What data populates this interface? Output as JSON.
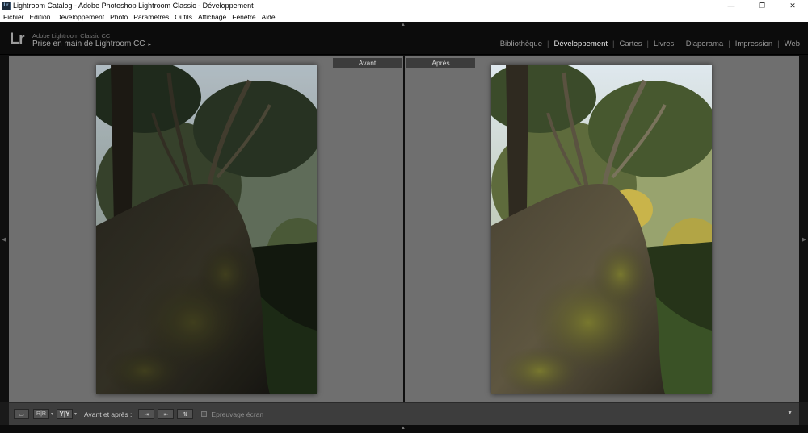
{
  "window": {
    "title": "Lightroom Catalog - Adobe Photoshop Lightroom Classic - Développement",
    "icon_label": "Lr",
    "controls": {
      "minimize": "—",
      "restore": "❐",
      "close": "✕"
    }
  },
  "menubar": {
    "items": [
      "Fichier",
      "Edition",
      "Développement",
      "Photo",
      "Paramètres",
      "Outils",
      "Affichage",
      "Fenêtre",
      "Aide"
    ]
  },
  "identity": {
    "logo": "Lr",
    "product": "Adobe Lightroom Classic CC",
    "catalog": "Prise en main de Lightroom CC",
    "caret": "▸"
  },
  "modules": {
    "items": [
      "Bibliothèque",
      "Développement",
      "Cartes",
      "Livres",
      "Diaporama",
      "Impression",
      "Web"
    ],
    "active_index": 1,
    "separator": "|"
  },
  "compare": {
    "before_label": "Avant",
    "after_label": "Après"
  },
  "toolbar": {
    "view_loupe": "▭",
    "view_before_after_lr": "R|R",
    "view_before_after_yy": "Y|Y",
    "dropdown": "▾",
    "before_after_label": "Avant et après :",
    "copy_before_to_after": "⇥",
    "copy_after_to_before": "⇤",
    "swap": "⇅",
    "soft_proof_label": "Epreuvage écran",
    "toolbar_menu": "▼"
  },
  "panel_arrows": {
    "top": "▲",
    "bottom": "▲",
    "left": "◀",
    "right": "▶"
  },
  "colors": {
    "background": "#6f6f6f",
    "chrome": "#0c0c0c",
    "active_module": "#e6e6e6",
    "inactive_module": "#9a9a9a"
  }
}
